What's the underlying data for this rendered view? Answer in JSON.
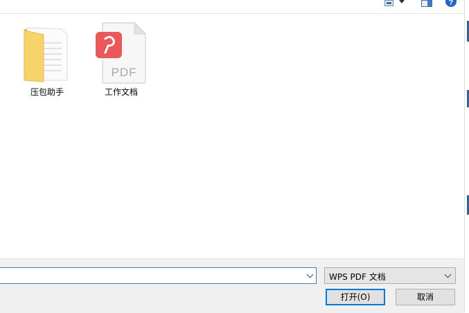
{
  "toolbar": {
    "view_icon": "view-options-icon",
    "preview_pane_icon": "preview-pane-icon",
    "help_icon": "help-icon",
    "help_glyph": "?"
  },
  "files": [
    {
      "name": "压包助手",
      "icon": "folder-icon"
    },
    {
      "name": "工作文档",
      "icon": "pdf-file-icon",
      "icon_text": "PDF"
    }
  ],
  "bottom": {
    "filename_value": "",
    "filetype_selected": "WPS PDF 文档",
    "open_label": "打开(O)",
    "cancel_label": "取消"
  },
  "colors": {
    "accent": "#0078d7",
    "pdf_badge": "#e9585a",
    "folder": "#f6d36b"
  }
}
